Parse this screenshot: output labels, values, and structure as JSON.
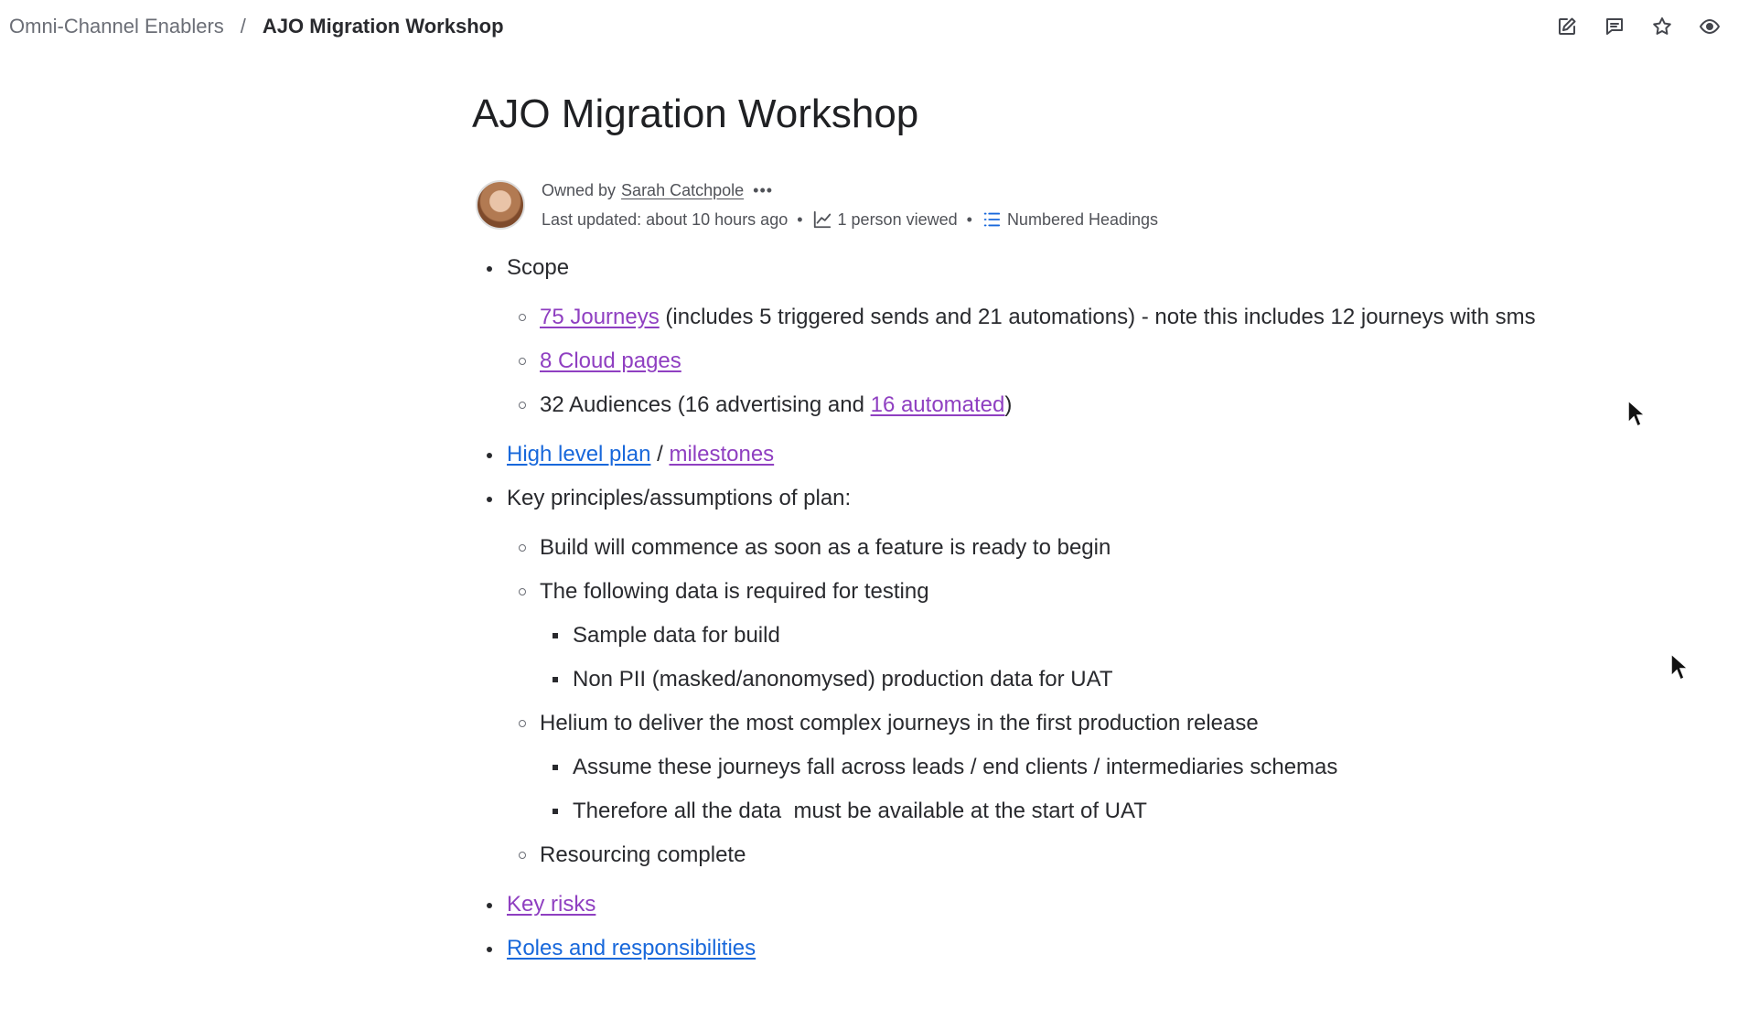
{
  "breadcrumb": {
    "parent": "Omni-Channel Enablers",
    "separator": "/",
    "current": "AJO Migration Workshop"
  },
  "header_actions": [
    {
      "name": "edit-icon"
    },
    {
      "name": "comment-icon"
    },
    {
      "name": "star-icon"
    },
    {
      "name": "watch-icon"
    }
  ],
  "page": {
    "title": "AJO Migration Workshop",
    "byline": {
      "owned_by_label": "Owned by",
      "owner": "Sarah Catchpole",
      "more": "•••",
      "last_updated": "Last updated: about 10 hours ago",
      "views": "1 person viewed",
      "numbered_headings": "Numbered Headings"
    }
  },
  "content": {
    "scope": {
      "label": "Scope",
      "journeys_link": "75 Journeys",
      "journeys_text": "(includes 5 triggered sends and 21 automations) - note this includes 12 journeys with sms",
      "cloud_pages_link": "8 Cloud pages",
      "audiences_text": "32 Audiences (16 advertising and ",
      "audiences_link": "16 automated",
      "audiences_close": ")"
    },
    "plan": {
      "plan_link": "High level plan",
      "separator": "/",
      "milestones_link": "milestones"
    },
    "principles": {
      "label": "Key principles/assumptions of plan:",
      "build": "Build will commence as soon as a feature is ready to begin",
      "data_required": "The following data is required for testing",
      "sample_data": "Sample data for build",
      "non_pii": "Non PII (masked/anonomysed) production data for UAT",
      "helium": "Helium to deliver the most complex journeys in the first production release",
      "assume": "Assume these journeys fall across leads / end clients / intermediaries schemas",
      "therefore": "Therefore all the data  must be available at the start of UAT",
      "resourcing": "Resourcing complete"
    },
    "key_risks_link": "Key risks",
    "roles_link": "Roles and responsibilities"
  },
  "colors": {
    "link_visited": "#8f3fc1",
    "link": "#1868db",
    "text": "#292a2e",
    "muted": "#505258"
  }
}
